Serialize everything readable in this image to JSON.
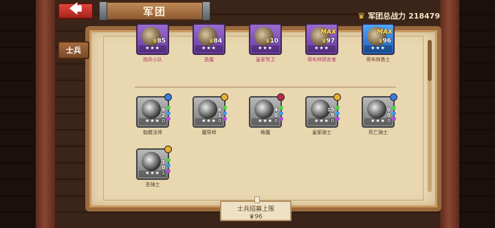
{
  "header": {
    "back_icon": "back-arrow-icon",
    "title": "军团",
    "power_label": "军团总战力",
    "power_value": "218479"
  },
  "side_tab": {
    "label": "士兵"
  },
  "colors": {
    "purple_card": "#8a5ac6",
    "blue_card": "#3a8ae6",
    "grey_card": "#9a9a9a",
    "parchment": "#e9d7b0"
  },
  "top_units": [
    {
      "name": "炮兵小队",
      "level": "85",
      "rarity": "purple",
      "max": ""
    },
    {
      "name": "恶魔",
      "level": "84",
      "rarity": "purple",
      "max": ""
    },
    {
      "name": "皇家弩卫",
      "level": "10",
      "rarity": "purple",
      "max": ""
    },
    {
      "name": "哥布林预言者",
      "level": "97",
      "rarity": "purple",
      "max": "MAX"
    },
    {
      "name": "哥布林勇士",
      "level": "96",
      "rarity": "blue",
      "max": "MAX"
    }
  ],
  "locked_units": [
    {
      "name": "骷髅法师",
      "counts": [
        "9",
        "2",
        "0"
      ]
    },
    {
      "name": "魔导师",
      "counts": [
        "6",
        "1",
        "0"
      ]
    },
    {
      "name": "蛛魔",
      "counts": [
        "4",
        "0",
        "0"
      ]
    },
    {
      "name": "皇家骑士",
      "counts": [
        "15",
        "9",
        "0"
      ]
    },
    {
      "name": "死亡骑士",
      "counts": [
        "0",
        "0",
        "0"
      ]
    },
    {
      "name": "圣骑士",
      "counts": [
        "1",
        "0",
        "1"
      ]
    }
  ],
  "capacity": {
    "label": "士兵招募上限",
    "value": "96"
  }
}
